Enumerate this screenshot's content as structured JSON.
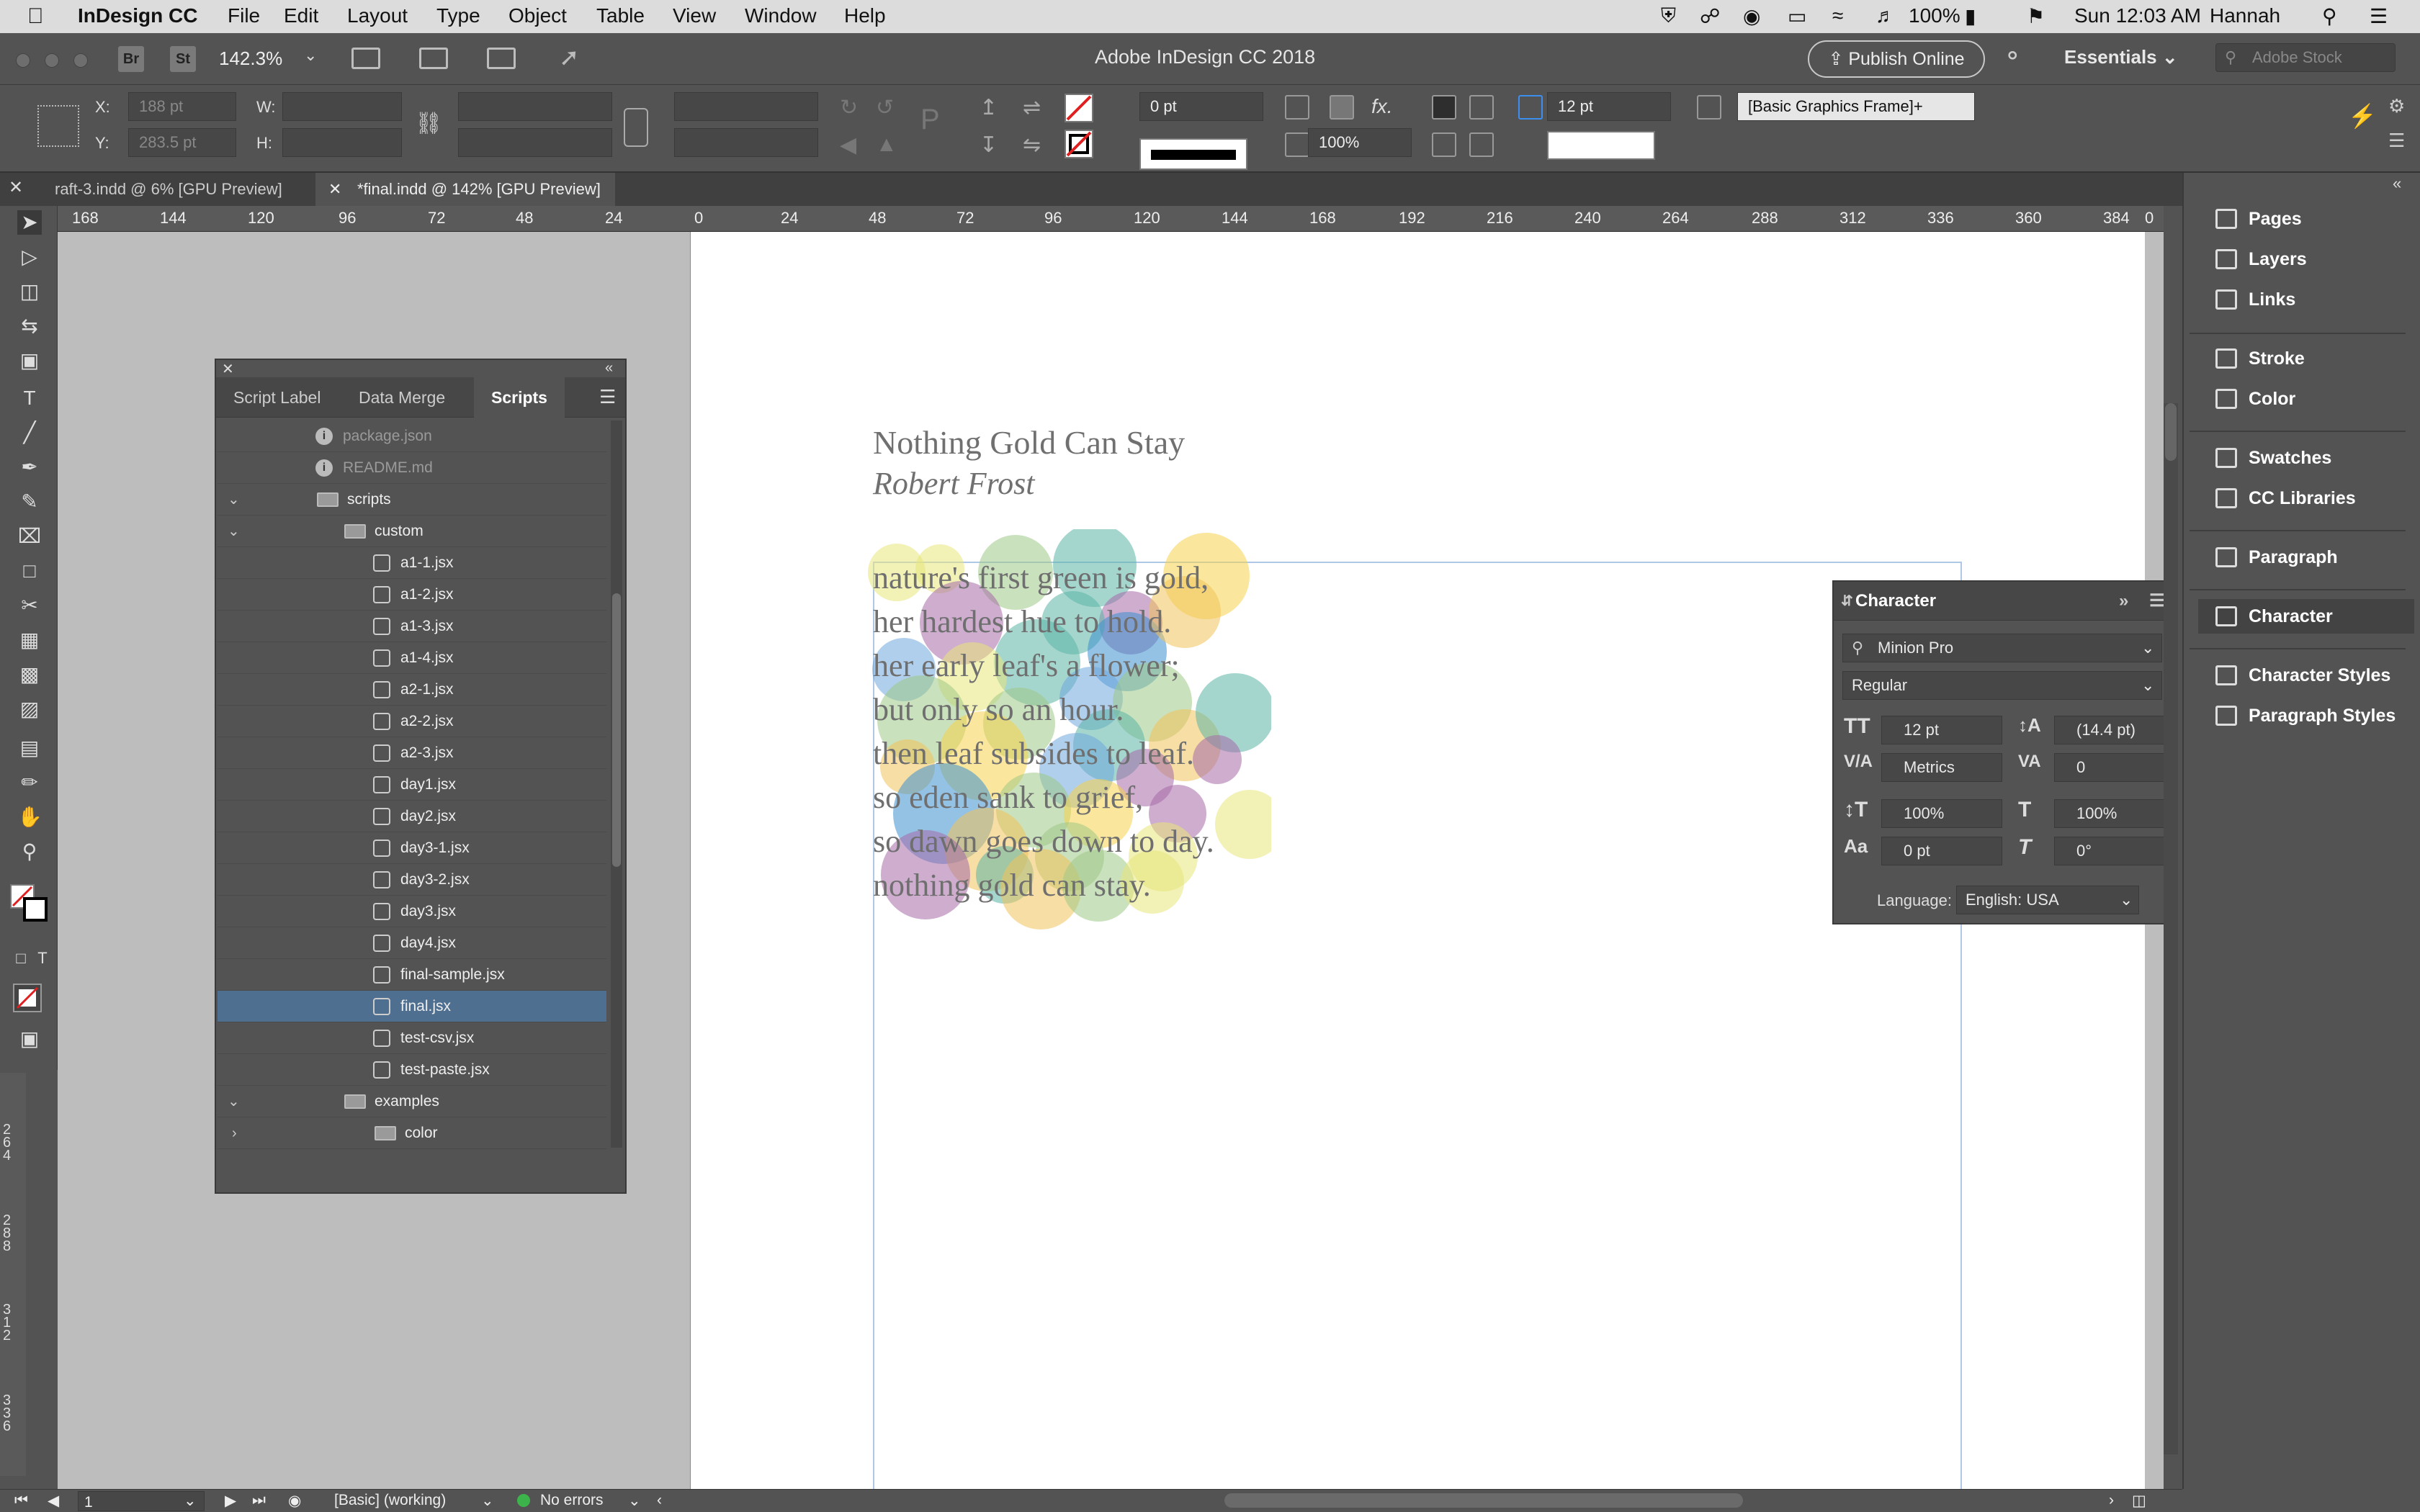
{
  "menubar": {
    "app_name": "InDesign CC",
    "items": [
      "File",
      "Edit",
      "Layout",
      "Type",
      "Object",
      "Table",
      "View",
      "Window",
      "Help"
    ],
    "battery": "100%",
    "clock": "Sun 12:03 AM",
    "user": "Hannah"
  },
  "appbar": {
    "bridge": "Br",
    "stock_app": "St",
    "zoom": "142.3%",
    "title": "Adobe InDesign CC 2018",
    "publish_label": "Publish Online",
    "workspace": "Essentials",
    "stock_placeholder": "Adobe Stock"
  },
  "control": {
    "x_label": "X:",
    "x_value": "188 pt",
    "y_label": "Y:",
    "y_value": "283.5 pt",
    "w_label": "W:",
    "h_label": "H:",
    "stroke_weight": "0 pt",
    "opacity": "100%",
    "spacing": "12 pt",
    "object_style": "[Basic Graphics Frame]+"
  },
  "tabs": [
    {
      "label": "raft-3.indd @ 6% [GPU Preview]"
    },
    {
      "label": "*final.indd @ 142% [GPU Preview]"
    }
  ],
  "ruler": {
    "ticks": [
      "168",
      "144",
      "120",
      "96",
      "72",
      "48",
      "24",
      "0",
      "24",
      "48",
      "72",
      "96",
      "120",
      "144",
      "168",
      "192",
      "216",
      "240",
      "264",
      "288",
      "312",
      "336",
      "360",
      "384",
      "0"
    ],
    "vticks": [
      "264",
      "288",
      "312",
      "336"
    ]
  },
  "document": {
    "title": "Nothing Gold Can Stay",
    "author": "Robert Frost",
    "lines": [
      "nature's first green is gold,",
      "her hardest hue to hold.",
      "her early leaf's a flower;",
      "but only so an hour.",
      "then leaf subsides to leaf.",
      "so eden sank to grief,",
      "so dawn goes down to day.",
      "nothing gold can stay."
    ],
    "bubble_colors": [
      "#5bb5a6",
      "#f5d24a",
      "#a56aa8",
      "#6fa8dc",
      "#9ec987",
      "#e8e67a",
      "#3d8fcf",
      "#f0c35a"
    ]
  },
  "scripts_panel": {
    "tabs": [
      "Script Label",
      "Data Merge",
      "Scripts"
    ],
    "rows": [
      {
        "name": "package.json",
        "kind": "info",
        "indent": 2,
        "dim": true
      },
      {
        "name": "README.md",
        "kind": "info",
        "indent": 2,
        "dim": true
      },
      {
        "name": "scripts",
        "kind": "folder",
        "indent": 2,
        "open": true
      },
      {
        "name": "custom",
        "kind": "folder",
        "indent": 3,
        "open": true
      },
      {
        "name": "a1-1.jsx",
        "kind": "script",
        "indent": 4
      },
      {
        "name": "a1-2.jsx",
        "kind": "script",
        "indent": 4
      },
      {
        "name": "a1-3.jsx",
        "kind": "script",
        "indent": 4
      },
      {
        "name": "a1-4.jsx",
        "kind": "script",
        "indent": 4
      },
      {
        "name": "a2-1.jsx",
        "kind": "script",
        "indent": 4
      },
      {
        "name": "a2-2.jsx",
        "kind": "script",
        "indent": 4
      },
      {
        "name": "a2-3.jsx",
        "kind": "script",
        "indent": 4
      },
      {
        "name": "day1.jsx",
        "kind": "script",
        "indent": 4
      },
      {
        "name": "day2.jsx",
        "kind": "script",
        "indent": 4
      },
      {
        "name": "day3-1.jsx",
        "kind": "script",
        "indent": 4
      },
      {
        "name": "day3-2.jsx",
        "kind": "script",
        "indent": 4
      },
      {
        "name": "day3.jsx",
        "kind": "script",
        "indent": 4
      },
      {
        "name": "day4.jsx",
        "kind": "script",
        "indent": 4
      },
      {
        "name": "final-sample.jsx",
        "kind": "script",
        "indent": 4
      },
      {
        "name": "final.jsx",
        "kind": "script",
        "indent": 4,
        "selected": true
      },
      {
        "name": "test-csv.jsx",
        "kind": "script",
        "indent": 4
      },
      {
        "name": "test-paste.jsx",
        "kind": "script",
        "indent": 4
      },
      {
        "name": "examples",
        "kind": "folder",
        "indent": 3,
        "open": true
      },
      {
        "name": "color",
        "kind": "folder",
        "indent": 4,
        "open": false
      }
    ]
  },
  "character_panel": {
    "title": "Character",
    "font_family": "Minion Pro",
    "font_style": "Regular",
    "size": "12 pt",
    "leading": "(14.4 pt)",
    "kerning": "Metrics",
    "tracking": "0",
    "vertical_scale": "100%",
    "horizontal_scale": "100%",
    "baseline_shift": "0 pt",
    "skew": "0°",
    "language_label": "Language:",
    "language": "English: USA"
  },
  "dock": {
    "items": [
      "Pages",
      "Layers",
      "Links",
      "Stroke",
      "Color",
      "Swatches",
      "CC Libraries",
      "Paragraph",
      "Character",
      "Character Styles",
      "Paragraph Styles"
    ],
    "active": "Character"
  },
  "status": {
    "page": "1",
    "preflight_profile": "[Basic] (working)",
    "errors": "No errors"
  }
}
